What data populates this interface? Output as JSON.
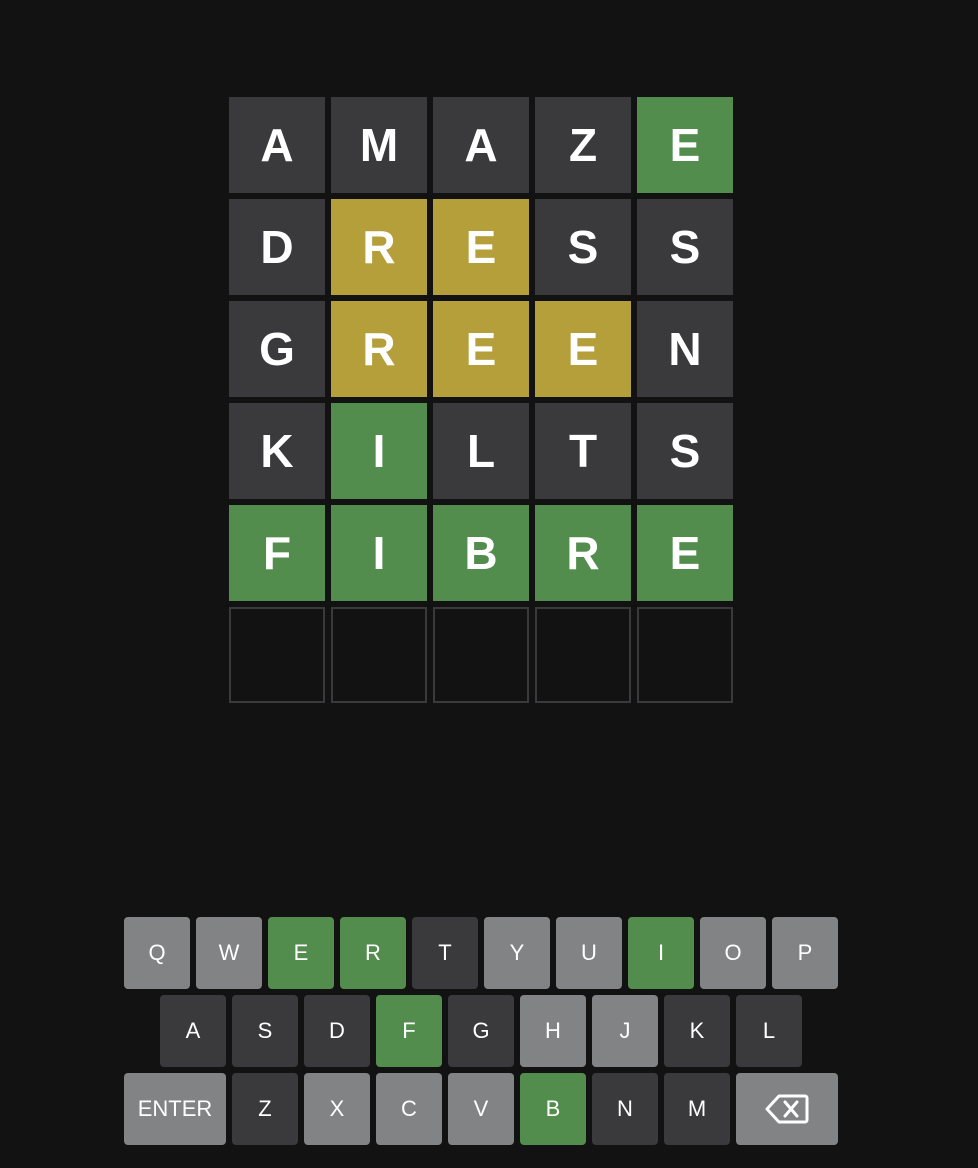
{
  "colors": {
    "background": "#121213",
    "absent": "#3a3a3c",
    "present": "#b59f3b",
    "correct": "#538d4e",
    "key_unused": "#818384",
    "empty_border": "#3a3a3c",
    "text": "#ffffff"
  },
  "board": {
    "rows": [
      {
        "tiles": [
          {
            "letter": "A",
            "state": "absent"
          },
          {
            "letter": "M",
            "state": "absent"
          },
          {
            "letter": "A",
            "state": "absent"
          },
          {
            "letter": "Z",
            "state": "absent"
          },
          {
            "letter": "E",
            "state": "correct"
          }
        ]
      },
      {
        "tiles": [
          {
            "letter": "D",
            "state": "absent"
          },
          {
            "letter": "R",
            "state": "present"
          },
          {
            "letter": "E",
            "state": "present"
          },
          {
            "letter": "S",
            "state": "absent"
          },
          {
            "letter": "S",
            "state": "absent"
          }
        ]
      },
      {
        "tiles": [
          {
            "letter": "G",
            "state": "absent"
          },
          {
            "letter": "R",
            "state": "present"
          },
          {
            "letter": "E",
            "state": "present"
          },
          {
            "letter": "E",
            "state": "present"
          },
          {
            "letter": "N",
            "state": "absent"
          }
        ]
      },
      {
        "tiles": [
          {
            "letter": "K",
            "state": "absent"
          },
          {
            "letter": "I",
            "state": "correct"
          },
          {
            "letter": "L",
            "state": "absent"
          },
          {
            "letter": "T",
            "state": "absent"
          },
          {
            "letter": "S",
            "state": "absent"
          }
        ]
      },
      {
        "tiles": [
          {
            "letter": "F",
            "state": "correct"
          },
          {
            "letter": "I",
            "state": "correct"
          },
          {
            "letter": "B",
            "state": "correct"
          },
          {
            "letter": "R",
            "state": "correct"
          },
          {
            "letter": "E",
            "state": "correct"
          }
        ]
      },
      {
        "tiles": [
          {
            "letter": "",
            "state": "empty"
          },
          {
            "letter": "",
            "state": "empty"
          },
          {
            "letter": "",
            "state": "empty"
          },
          {
            "letter": "",
            "state": "empty"
          },
          {
            "letter": "",
            "state": "empty"
          }
        ]
      }
    ]
  },
  "keyboard": {
    "rows": [
      {
        "keys": [
          {
            "label": "Q",
            "state": "unused"
          },
          {
            "label": "W",
            "state": "unused"
          },
          {
            "label": "E",
            "state": "correct"
          },
          {
            "label": "R",
            "state": "correct"
          },
          {
            "label": "T",
            "state": "absent"
          },
          {
            "label": "Y",
            "state": "unused"
          },
          {
            "label": "U",
            "state": "unused"
          },
          {
            "label": "I",
            "state": "correct"
          },
          {
            "label": "O",
            "state": "unused"
          },
          {
            "label": "P",
            "state": "unused"
          }
        ]
      },
      {
        "keys": [
          {
            "label": "A",
            "state": "absent"
          },
          {
            "label": "S",
            "state": "absent"
          },
          {
            "label": "D",
            "state": "absent"
          },
          {
            "label": "F",
            "state": "correct"
          },
          {
            "label": "G",
            "state": "absent"
          },
          {
            "label": "H",
            "state": "unused"
          },
          {
            "label": "J",
            "state": "unused"
          },
          {
            "label": "K",
            "state": "absent"
          },
          {
            "label": "L",
            "state": "absent"
          }
        ]
      },
      {
        "keys": [
          {
            "label": "ENTER",
            "state": "unused",
            "kind": "enter"
          },
          {
            "label": "Z",
            "state": "absent"
          },
          {
            "label": "X",
            "state": "unused"
          },
          {
            "label": "C",
            "state": "unused"
          },
          {
            "label": "V",
            "state": "unused"
          },
          {
            "label": "B",
            "state": "correct"
          },
          {
            "label": "N",
            "state": "absent"
          },
          {
            "label": "M",
            "state": "absent"
          },
          {
            "label": "",
            "state": "unused",
            "kind": "backspace",
            "icon": "backspace-icon"
          }
        ]
      }
    ]
  }
}
